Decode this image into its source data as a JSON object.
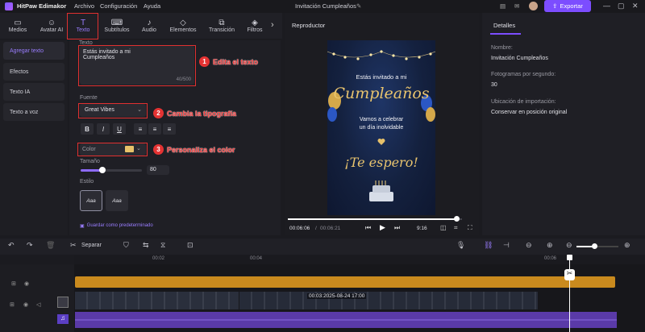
{
  "app": {
    "name": "HitPaw Edimakor",
    "menu": [
      "Archivo",
      "Configuración",
      "Ayuda"
    ],
    "project_title": "Invitación Cumpleaños",
    "export_label": "Exportar"
  },
  "tabs": [
    {
      "label": "Medios",
      "icon": "▭"
    },
    {
      "label": "Avatar AI",
      "icon": "☺"
    },
    {
      "label": "Texto",
      "icon": "T"
    },
    {
      "label": "Subtítulos",
      "icon": "⌨"
    },
    {
      "label": "Audio",
      "icon": "♪"
    },
    {
      "label": "Elementos",
      "icon": "◇"
    },
    {
      "label": "Transición",
      "icon": "⧉"
    },
    {
      "label": "Filtros",
      "icon": "◈"
    }
  ],
  "leftnav": [
    "Agregar texto",
    "Efectos",
    "Texto IA",
    "Texto a voz"
  ],
  "props": {
    "text_label": "Texto",
    "text_value_line1": "Estás invitado a mi",
    "text_value_line2": "Cumpleaños",
    "char_count": "40/500",
    "font_label": "Fuente",
    "font_value": "Great Vibes",
    "color_label": "Color",
    "color_swatch": "#e8c26a",
    "size_label": "Tamaño",
    "size_value": "80",
    "size_fraction": 0.35,
    "style_label": "Estilo",
    "style_options": [
      "Aaa",
      "Aaa"
    ],
    "save_default": "Guardar como predeterminado",
    "format_buttons": [
      "B",
      "I",
      "U"
    ]
  },
  "callouts": [
    {
      "num": "1",
      "text": "Edita el texto"
    },
    {
      "num": "2",
      "text": "Cambia la tipografía"
    },
    {
      "num": "3",
      "text": "Personaliza el color"
    }
  ],
  "player": {
    "title": "Reproductor",
    "card_line1": "Estás invitado a mi",
    "card_line2": "Cumpleaños",
    "card_line3": "Vamos a celebrar",
    "card_line4": "un día inolvidable",
    "card_line5": "¡Te espero!",
    "time_current": "00:06:06",
    "time_total": "00:06:21",
    "aspect": "9:16",
    "progress_fraction": 0.97
  },
  "details": {
    "tab": "Detalles",
    "name_label": "Nombre:",
    "name_value": "Invitación Cumpleaños",
    "fps_label": "Fotogramas por segundo:",
    "fps_value": "30",
    "location_label": "Ubicación de importación:",
    "location_value": "Conservar en posición original"
  },
  "timeline": {
    "split_label": "Separar",
    "ruler_ticks": [
      "00:02",
      "00:04",
      "00:06"
    ],
    "clip_label": "00:03:2025-08-24 17:00"
  },
  "colors": {
    "accent": "#7c4dff",
    "text_track": "#c98a1e",
    "audio_track": "#5a3aa8",
    "callout": "#e53333"
  }
}
